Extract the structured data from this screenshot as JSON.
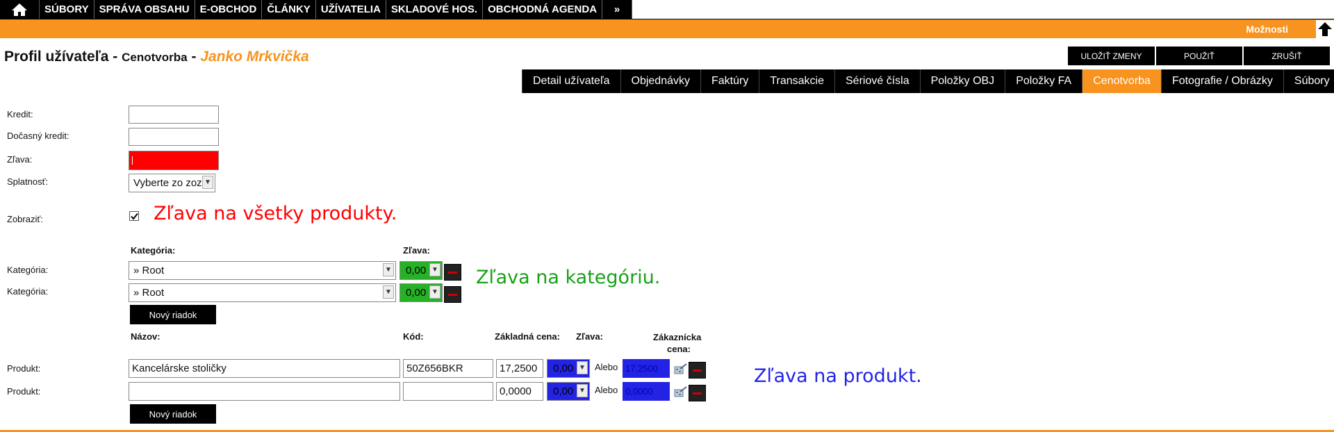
{
  "topnav": {
    "items": [
      "SÚBORY",
      "SPRÁVA OBSAHU",
      "E-OBCHOD",
      "ČLÁNKY",
      "UŽÍVATELIA",
      "SKLADOVÉ HOS.",
      "OBCHODNÁ AGENDA"
    ],
    "more": "»"
  },
  "options_label": "Možnosti",
  "title": {
    "main": "Profil užívateľa",
    "dash1": " - ",
    "section": "Cenotvorba",
    "dash2": " - ",
    "user": "Janko Mrkvička"
  },
  "actions": {
    "save": "ULOŽIŤ ZMENY",
    "apply": "POUŽIŤ",
    "cancel": "ZRUŠIŤ"
  },
  "tabs": [
    {
      "label": "Detail užívateľa",
      "active": false
    },
    {
      "label": "Objednávky",
      "active": false
    },
    {
      "label": "Faktúry",
      "active": false
    },
    {
      "label": "Transakcie",
      "active": false
    },
    {
      "label": "Sériové čísla",
      "active": false
    },
    {
      "label": "Položky OBJ",
      "active": false
    },
    {
      "label": "Položky FA",
      "active": false
    },
    {
      "label": "Cenotvorba",
      "active": true
    },
    {
      "label": "Fotografie / Obrázky",
      "active": false
    },
    {
      "label": "Súbory",
      "active": false
    }
  ],
  "form": {
    "credit_label": "Kredit:",
    "credit_value": "",
    "temp_credit_label": "Dočasný kredit:",
    "temp_credit_value": "",
    "discount_label": "Zľava:",
    "discount_value": "",
    "due_label": "Splatnosť:",
    "due_value": "Vyberte zo zoz",
    "show_label": "Zobraziť:",
    "show_checked": true
  },
  "annotations": {
    "all_products": "Zľava na všetky produkty.",
    "category": "Zľava na kategóriu.",
    "product": "Zľava na produkt."
  },
  "category_section": {
    "col_category": "Kategória:",
    "col_discount": "Zľava:",
    "rows": [
      {
        "label": "Kategória:",
        "category": "» Root",
        "discount": "0,00"
      },
      {
        "label": "Kategória:",
        "category": "» Root",
        "discount": "0,00"
      }
    ],
    "new_row": "Nový riadok"
  },
  "product_section": {
    "col_name": "Názov:",
    "col_code": "Kód:",
    "col_base_price": "Základná cena:",
    "col_discount": "Zľava:",
    "col_customer_price_1": "Zákaznícka",
    "col_customer_price_2": "cena:",
    "or_label": "Alebo",
    "rows": [
      {
        "label": "Produkt:",
        "name": "Kancelárske stoličky",
        "code": "50Z656BKR",
        "base_price": "17,2500",
        "discount": "0,00",
        "customer_price": "17,2500"
      },
      {
        "label": "Produkt:",
        "name": "",
        "code": "",
        "base_price": "0,0000",
        "discount": "0,00",
        "customer_price": "0,0000"
      }
    ],
    "new_row": "Nový riadok"
  },
  "colors": {
    "accent": "#f7931e",
    "red_annotation": "#ff0000",
    "green_annotation": "#16a216",
    "blue_annotation": "#2323e6"
  }
}
